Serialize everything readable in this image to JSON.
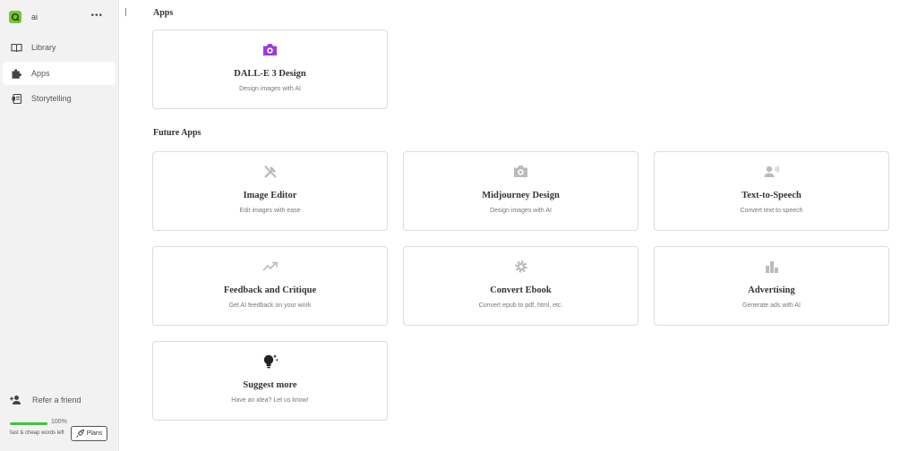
{
  "colors": {
    "accent_purple": "#9b3dd6",
    "usage_green": "#3ec53e",
    "logo_green": "#7cc431"
  },
  "sidebar": {
    "workspace_name": "ai",
    "more": "•••",
    "items": [
      {
        "label": "Library",
        "icon": "book-icon"
      },
      {
        "label": "Apps",
        "icon": "puzzle-icon",
        "active": true
      },
      {
        "label": "Storytelling",
        "icon": "scroll-icon"
      }
    ],
    "refer_label": "Refer a friend",
    "usage": {
      "percent_label": "100%",
      "percent": 100,
      "text": "fast & cheap words left"
    },
    "plans_label": "Plans"
  },
  "main": {
    "apps_title": "Apps",
    "future_title": "Future Apps",
    "apps": [
      {
        "title": "DALL-E 3 Design",
        "desc": "Design images with AI",
        "icon": "camera-icon"
      }
    ],
    "future_apps": [
      {
        "title": "Image Editor",
        "desc": "Edit images with ease",
        "icon": "tools-icon"
      },
      {
        "title": "Midjourney Design",
        "desc": "Design images with AI",
        "icon": "camera-icon"
      },
      {
        "title": "Text-to-Speech",
        "desc": "Convert text to speech",
        "icon": "speaker-icon"
      },
      {
        "title": "Feedback and Critique",
        "desc": "Get AI feedback on your work",
        "icon": "trending-icon"
      },
      {
        "title": "Convert Ebook",
        "desc": "Convert epub to pdf, html, etc.",
        "icon": "gear-icon"
      },
      {
        "title": "Advertising",
        "desc": "Generate ads with AI",
        "icon": "bar-chart-icon"
      },
      {
        "title": "Suggest more",
        "desc": "Have an idea? Let us know!",
        "icon": "lightbulb-icon"
      }
    ]
  }
}
